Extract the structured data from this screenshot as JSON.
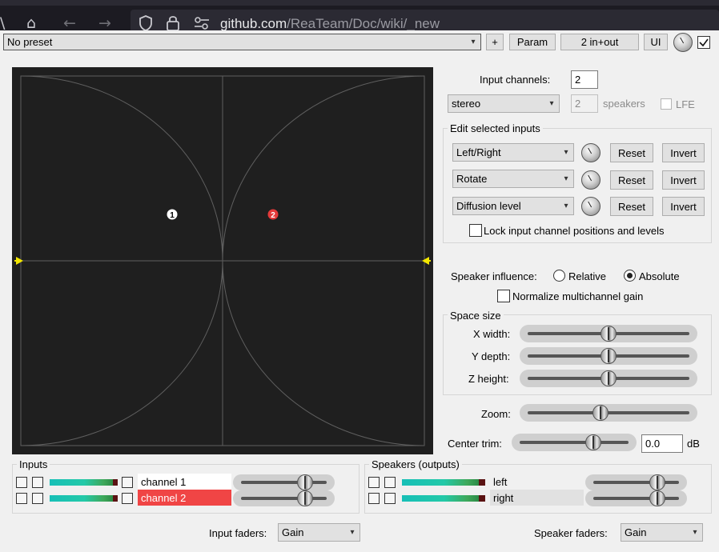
{
  "browser": {
    "url_host": "github.com",
    "url_path": "/ReaTeam/Doc/wiki/_new",
    "icons": [
      "home-icon",
      "back-icon",
      "forward-icon",
      "shield-icon",
      "lock-icon",
      "permissions-icon"
    ]
  },
  "toolbar": {
    "preset": "No preset",
    "plus_label": "+",
    "param_label": "Param",
    "io_label": "2 in+out",
    "ui_label": "UI"
  },
  "panner": {
    "input_points": [
      {
        "label": "1",
        "color": "#ffffff",
        "text_color": "#000000"
      },
      {
        "label": "2",
        "color": "#e53a3a",
        "text_color": "#ffffff"
      }
    ],
    "colors": {
      "background": "#1f1f1f",
      "lines": "#5f5f5f",
      "markers": "#f2e600"
    }
  },
  "config": {
    "input_channels_label": "Input channels:",
    "input_channels_value": "2",
    "layout": "stereo",
    "speakers_value": "2",
    "speakers_label": "speakers",
    "lfe_label": "LFE"
  },
  "edit_inputs": {
    "title": "Edit selected inputs",
    "rows": [
      {
        "param": "Left/Right",
        "reset": "Reset",
        "invert": "Invert"
      },
      {
        "param": "Rotate",
        "reset": "Reset",
        "invert": "Invert"
      },
      {
        "param": "Diffusion level",
        "reset": "Reset",
        "invert": "Invert"
      }
    ],
    "lock_label": "Lock input channel positions and levels"
  },
  "influence": {
    "label": "Speaker influence:",
    "relative": "Relative",
    "absolute": "Absolute",
    "selected": "absolute",
    "normalize_label": "Normalize multichannel gain"
  },
  "space": {
    "title": "Space size",
    "x_label": "X width:",
    "y_label": "Y depth:",
    "z_label": "Z height:",
    "x_value": 0.5,
    "y_value": 0.5,
    "z_value": 0.5
  },
  "zoom": {
    "label": "Zoom:",
    "value": 0.45
  },
  "center_trim": {
    "label": "Center trim:",
    "value": "0.0",
    "unit": "dB",
    "slider_value": 0.68
  },
  "inputs": {
    "title": "Inputs",
    "channels": [
      {
        "name": "channel 1",
        "bg": "#ffffff",
        "fader": 0.75
      },
      {
        "name": "channel 2",
        "bg": "#f04545",
        "fader": 0.75
      }
    ]
  },
  "speakers": {
    "title": "Speakers (outputs)",
    "channels": [
      {
        "name": "left",
        "fader": 0.75
      },
      {
        "name": "right",
        "fader": 0.75
      }
    ]
  },
  "footer": {
    "input_faders_label": "Input faders:",
    "input_faders_value": "Gain",
    "speaker_faders_label": "Speaker faders:",
    "speaker_faders_value": "Gain"
  }
}
